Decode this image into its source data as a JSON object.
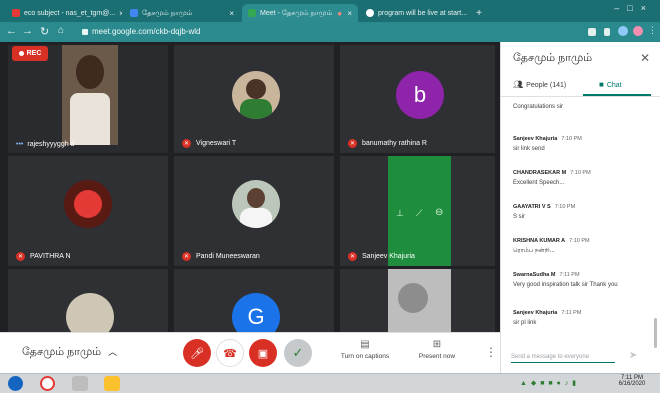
{
  "browser": {
    "tabs": [
      {
        "label": "eco subject - nas_et_tgm@..."
      },
      {
        "label": "தேசமும் நாமும்"
      },
      {
        "label": "Meet - தேசமும் நாமும்"
      },
      {
        "label": "program will be live at start..."
      }
    ],
    "url": "meet.google.com/ckb-dqjb-wld"
  },
  "meeting": {
    "rec_label": "REC",
    "title": "தேசமும் நாமும்",
    "participants": [
      {
        "name": "rajeshyyyggh d"
      },
      {
        "name": "Vigneswari T"
      },
      {
        "name": "banumathy rathina R",
        "initial": "b"
      },
      {
        "name": "PAVITHRA N"
      },
      {
        "name": "Pandi Muneeswaran"
      },
      {
        "name": "Sanjeev Khajuria"
      },
      {
        "name": ""
      },
      {
        "initial": "G"
      },
      {
        "name": ""
      }
    ]
  },
  "controls": {
    "captions_label": "Turn on captions",
    "present_label": "Present now"
  },
  "panel": {
    "title": "தேசமும் நாமும்",
    "people_tab": "People (141)",
    "chat_tab": "Chat",
    "messages": [
      {
        "sender": "",
        "time": "",
        "text": "Congratulations sir"
      },
      {
        "sender": "Sanjeev Khajuria",
        "time": "7:10 PM",
        "text": "sir link send"
      },
      {
        "sender": "CHANDRASEKAR M",
        "time": "7:10 PM",
        "text": "Excellent Speech..."
      },
      {
        "sender": "GAAYATRI V S",
        "time": "7:10 PM",
        "text": "S sir"
      },
      {
        "sender": "KRISHNA KUMAR A",
        "time": "7:10 PM",
        "text": "ரொம்ப நன்றி..."
      },
      {
        "sender": "SwarnaSudha M",
        "time": "7:11 PM",
        "text": "Very good inspiration talk sir Thank you"
      },
      {
        "sender": "Sanjeev Khajuria",
        "time": "7:11 PM",
        "text": "sir pl link"
      }
    ],
    "send_placeholder": "Send a message to everyone"
  },
  "taskbar": {
    "time": "7:11 PM",
    "date": "6/16/2020"
  },
  "colors": {
    "chrome": "#1b6f73",
    "meet_bg": "#202124",
    "red": "#d93025",
    "accent": "#00796b",
    "avatar_purple": "#8e24aa",
    "avatar_blue": "#1a73e8",
    "green_tile": "#1e8e3e"
  }
}
